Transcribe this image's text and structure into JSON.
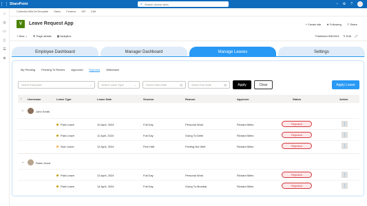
{
  "suite": {
    "brand": "SharePoint",
    "search_placeholder": "Search across sites"
  },
  "site_nav": [
    "CollectionSiteJerTemplate",
    "Sales",
    "Finance",
    "HR",
    "Edit"
  ],
  "app": {
    "logo_letter": "V",
    "title": "Leave Request App"
  },
  "site_actions": {
    "create_site": "+ Create site",
    "following": "Following",
    "share": "Share"
  },
  "command_bar": {
    "new": "+ New",
    "page_details": "Page details",
    "analytics": "Analytics",
    "published": "Published 5/8/2024",
    "edit": "Edit"
  },
  "tabs": [
    {
      "label": "Employee Dashboard",
      "active": false
    },
    {
      "label": "Manager Dashboard",
      "active": false
    },
    {
      "label": "Manage Leaves",
      "active": true
    },
    {
      "label": "Settings",
      "active": false
    }
  ],
  "subtabs": [
    {
      "label": "My Pending",
      "active": false
    },
    {
      "label": "Pending To Review",
      "active": false
    },
    {
      "label": "Approved",
      "active": false
    },
    {
      "label": "Rejected",
      "active": true
    },
    {
      "label": "Withdrawn",
      "active": false
    }
  ],
  "filters": {
    "employee_placeholder": "Select Employee",
    "leave_type_placeholder": "Select Leave Type",
    "start_date_placeholder": "Select Start Date",
    "end_date_placeholder": "Select End Date",
    "apply_label": "Apply",
    "clear_label": "Clear",
    "apply_leave_label": "Apply Leave"
  },
  "table": {
    "headers": [
      "Username",
      "Leave Type",
      "Leave Date",
      "Session",
      "Reason",
      "Approver",
      "Status",
      "Action"
    ],
    "groups": [
      {
        "user": "John Smith",
        "rows": [
          {
            "leave_type": "Paid Leave",
            "dot_color": "#c19c00",
            "date": "10 April, 2024",
            "session": "Full Day",
            "reason": "Personal Work",
            "approver": "Richard Miles",
            "status": "Rejected"
          },
          {
            "leave_type": "Paid Leave",
            "dot_color": "#c19c00",
            "date": "11 April, 2024",
            "session": "Full Day",
            "reason": "Going To Delhi",
            "approver": "Richard Miles",
            "status": "Rejected"
          },
          {
            "leave_type": "Sick Leave",
            "dot_color": "#ffaa44",
            "date": "12 April, 2024",
            "session": "First Half",
            "reason": "Feeling Not Well",
            "approver": "Richard Miles",
            "status": "Rejected"
          }
        ]
      },
      {
        "user": "Robin Hood",
        "rows": [
          {
            "leave_type": "Paid Leave",
            "dot_color": "#c19c00",
            "date": "13 April, 2024",
            "session": "Full Day",
            "reason": "Personal Work",
            "approver": "Richard Miles",
            "status": "Rejected"
          },
          {
            "leave_type": "Paid Leave",
            "dot_color": "#c19c00",
            "date": "14 April, 2024",
            "session": "Full Day",
            "reason": "Going To Mumbai",
            "approver": "Richard Miles",
            "status": "Rejected"
          }
        ]
      }
    ],
    "more_glyph": "⋮"
  },
  "colors": {
    "suite": "#0f6cbd",
    "accent": "#2899f5",
    "rejected": "#d13438"
  }
}
